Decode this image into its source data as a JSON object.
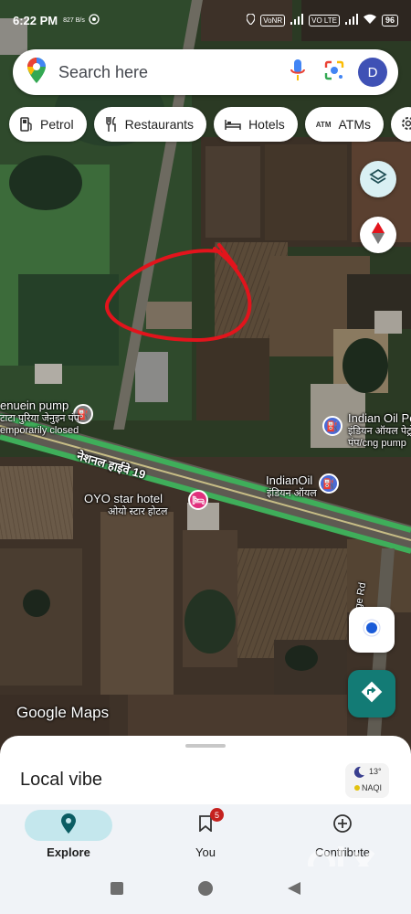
{
  "status_bar": {
    "time": "6:22 PM",
    "speed": "827 B/s",
    "vonr": "VoNR",
    "volte": "VO LTE",
    "battery": "96"
  },
  "search": {
    "placeholder": "Search here",
    "avatar_letter": "D"
  },
  "chips": [
    {
      "label": "Petrol",
      "icon": "fuel-pump-icon"
    },
    {
      "label": "Restaurants",
      "icon": "fork-knife-icon"
    },
    {
      "label": "Hotels",
      "icon": "bed-icon"
    },
    {
      "label": "ATMs",
      "icon": "atm-icon",
      "badge": "ATM"
    }
  ],
  "map": {
    "labels": {
      "pump_name_partial": "enuein pump",
      "pump_hindi": "टाटा पुरिया जेनुइन पंप",
      "pump_status": "emporarily closed",
      "highway_hindi": "नेशनल हाईवे 19",
      "indian_oil_1": "Indian Oil Pe",
      "indian_oil_1_hindi": "इंडियन ऑयल पेट्रोल",
      "indian_oil_1_sub": "पंप/cng pump",
      "indian_oil_2": "IndianOil",
      "indian_oil_2_hindi": "इंडियन ऑयल",
      "oyo": "OYO star hotel",
      "oyo_hindi": "ओयो स्टार होटल",
      "college_rd": "College Rd"
    },
    "google_logo": "Google Maps",
    "colors": {
      "highway": "#3fae5a",
      "red_annotation": "#e2141c",
      "fuel_poi": "#4b6bd6",
      "hotel_poi": "#e0307d"
    }
  },
  "sheet": {
    "title": "Local vibe",
    "weather_temp": "13°",
    "weather_aqi": "NAQI"
  },
  "nav": [
    {
      "label": "Explore",
      "icon": "explore-pin-icon",
      "active": true
    },
    {
      "label": "You",
      "icon": "bookmark-icon",
      "badge": "5"
    },
    {
      "label": "Contribute",
      "icon": "add-circle-icon"
    }
  ],
  "watermark": "olx"
}
